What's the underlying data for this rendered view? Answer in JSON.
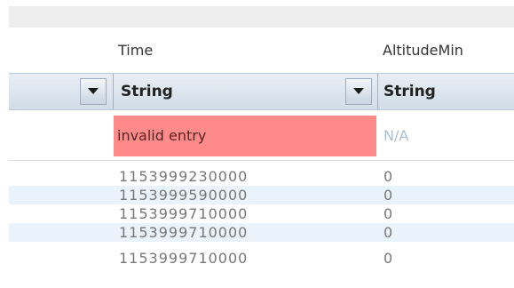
{
  "columns": [
    {
      "name": "Time",
      "type": "String"
    },
    {
      "name": "AltitudeMin",
      "type": "String"
    }
  ],
  "validation_row": {
    "time": "invalid entry",
    "altitude_min": "N/A"
  },
  "rows": [
    {
      "time": "1153999230000",
      "altitude_min": "0"
    },
    {
      "time": "1153999590000",
      "altitude_min": "0"
    },
    {
      "time": "1153999710000",
      "altitude_min": "0"
    },
    {
      "time": "1153999710000",
      "altitude_min": "0"
    },
    {
      "time": "1153999710000",
      "altitude_min": "0"
    }
  ],
  "colors": {
    "invalid_bg": "#ff8a8a",
    "alt_row_bg": "#eaf2fb",
    "na_text": "#aabed2"
  },
  "icons": {
    "dropdown": "chevron-down-icon"
  }
}
